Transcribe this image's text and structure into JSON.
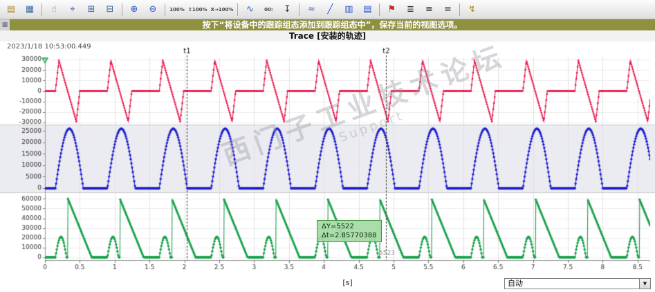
{
  "toolbar": {
    "items": [
      {
        "name": "copy-trace-button",
        "glyph": "▤",
        "color": "#b08a30"
      },
      {
        "name": "monitor-toggle-button",
        "glyph": "▦",
        "color": "#3a6fa8"
      },
      {
        "sep": true
      },
      {
        "name": "pan-hand-button",
        "glyph": "☝",
        "color": "#d2691e"
      },
      {
        "name": "zoom-select-button",
        "glyph": "⌖",
        "color": "#3a5f9e"
      },
      {
        "name": "zoom-area-in-button",
        "glyph": "⊞",
        "color": "#3a5f9e"
      },
      {
        "name": "zoom-area-out-button",
        "glyph": "⊟",
        "color": "#3a5f9e"
      },
      {
        "sep": true
      },
      {
        "name": "zoom-in-button",
        "glyph": "⊕",
        "color": "#2a56c6"
      },
      {
        "name": "zoom-out-button",
        "glyph": "⊖",
        "color": "#2a56c6"
      },
      {
        "sep": true
      },
      {
        "name": "zoom-100-button",
        "glyph": "100%",
        "small": true
      },
      {
        "name": "fit-vertical-button",
        "glyph": "↕100%",
        "small": true
      },
      {
        "name": "fit-horizontal-button",
        "glyph": "X→100%",
        "small": true
      },
      {
        "sep": true
      },
      {
        "name": "signal-samples-button",
        "glyph": "∿",
        "color": "#2a56c6"
      },
      {
        "name": "time-reference-button",
        "glyph": "00:",
        "small": true
      },
      {
        "name": "export-measurement-button",
        "glyph": "↧",
        "color": "#333333"
      },
      {
        "sep": true
      },
      {
        "name": "interpolation-button",
        "glyph": "≈",
        "color": "#2a56c6"
      },
      {
        "name": "line-style-button",
        "glyph": "╱",
        "color": "#2a56c6"
      },
      {
        "name": "vertical-bars-button",
        "glyph": "▥",
        "color": "#2a56c6"
      },
      {
        "name": "horizontal-rows-button",
        "glyph": "▤",
        "color": "#2a56c6"
      },
      {
        "sep": true
      },
      {
        "name": "measure-cursor-button",
        "glyph": "⚑",
        "color": "#c03030"
      },
      {
        "name": "legend-button",
        "glyph": "≣",
        "color": "#333333"
      },
      {
        "name": "align-left-button",
        "glyph": "≡",
        "color": "#333333"
      },
      {
        "name": "align-center-button",
        "glyph": "≡",
        "color": "#555555"
      },
      {
        "sep": true
      },
      {
        "name": "apply-button",
        "glyph": "↯",
        "color": "#a08800"
      }
    ]
  },
  "left_strip": {
    "icon": "▦"
  },
  "message": "按下“将设备中的跟踪组态添加到跟踪组态中”，保存当前的视图选项。",
  "title": "Trace [安装的轨迹]",
  "timestamp": "2023/1/18 10:53:00.449",
  "watermark": {
    "line1": "西门子工业技术论坛",
    "line2": "Support"
  },
  "tooltip": {
    "dy": "ΔY=5522",
    "dt": "Δt=2.85770388"
  },
  "measure_extra": "5523",
  "bottom": {
    "x_unit": "[s]",
    "dropdown_value": "自动",
    "dropdown_arrow": "▼"
  },
  "chart_data": {
    "type": "line",
    "x_label": "[s]",
    "x_ticks": [
      0,
      0.5,
      1,
      1.5,
      2,
      2.5,
      3,
      3.5,
      4,
      4.5,
      5,
      5.5,
      6,
      6.5,
      7,
      7.5,
      8,
      8.5
    ],
    "t_max": 8.68,
    "period": 0.745,
    "t_start": 0.15,
    "sample_dt": 0.005,
    "grid": true,
    "cursors": [
      {
        "label": "t1",
        "t": 2.035
      },
      {
        "label": "t2",
        "t": 4.8927
      }
    ],
    "trigger_marker_color": "#18a048",
    "panels": [
      {
        "signal": "position",
        "color": "#e8174b",
        "marker": "square",
        "ylim": [
          -32000,
          32000
        ],
        "ticks": [
          30000,
          20000,
          10000,
          0,
          -10000,
          -20000,
          -30000
        ],
        "wave": {
          "kind": "saw",
          "amp": 29000,
          "rise": 0.05,
          "ramp": 0.25,
          "fall": 0.05
        }
      },
      {
        "signal": "velocity",
        "color": "#2020cf",
        "marker": "diamond",
        "band": "#ebebf2",
        "ylim": [
          -1800,
          27500
        ],
        "ticks": [
          25000,
          20000,
          15000,
          10000,
          5000,
          0
        ],
        "wave": {
          "kind": "hump",
          "amp": 26000,
          "width": 0.4
        }
      },
      {
        "signal": "acceleration",
        "color": "#18a04b",
        "marker": "diamond",
        "ylim": [
          -3000,
          66000
        ],
        "ticks": [
          60000,
          50000,
          40000,
          30000,
          20000,
          10000,
          0
        ],
        "wave": {
          "kind": "decay",
          "hump_amp": 21000,
          "hump_width": 0.16,
          "peak": 60000,
          "decay_start": 0.18,
          "decay_end": 0.52
        }
      }
    ]
  }
}
